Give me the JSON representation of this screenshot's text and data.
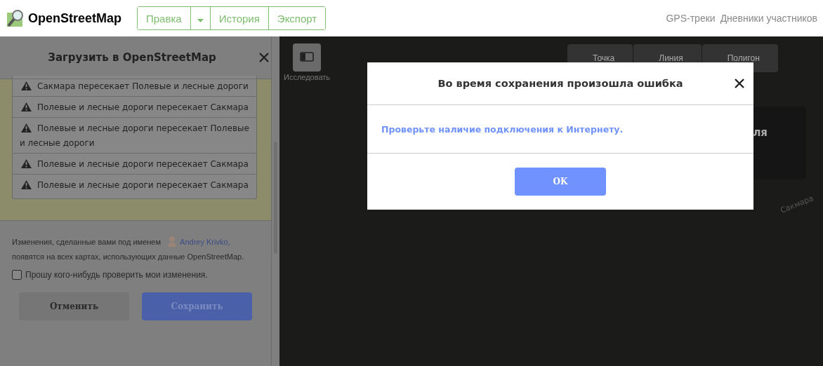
{
  "header": {
    "logo": "OpenStreetMap",
    "edit_tabs": [
      {
        "label": "Правка",
        "kind": "text"
      },
      {
        "kind": "dropdown"
      },
      {
        "label": "История",
        "kind": "text"
      },
      {
        "label": "Экспорт",
        "kind": "text"
      }
    ],
    "links": [
      "GPS-треки",
      "Дневники участников"
    ]
  },
  "upload_panel": {
    "title": "Загрузить в OpenStreetMap",
    "issues": [
      "Сакмара пересекает Полевые и лесные дороги",
      "Полевые и лесные дороги пересекает Сакмара",
      "Полевые и лесные дороги пересекает Полевые и лесные дороги",
      "Полевые и лесные дороги пересекает Сакмара",
      "Полевые и лесные дороги пересекает Сакмара"
    ],
    "info_before": "Изменения, сделанные вами под именем",
    "user": "Andrey Krivko,",
    "info_after": "появятся на всех картах, использующих данные OpenStreetMap.",
    "review": {
      "label": "Прошу кого-нибудь проверить мои изменения.",
      "checked": false
    },
    "cancel": "Отменить",
    "save": "Сохранить"
  },
  "map": {
    "explore_label": "Исследовать",
    "draw_tools": [
      "Точка",
      "Линия",
      "Полигон"
    ],
    "panel_fragment": "ля",
    "river_label": "Сакмара"
  },
  "dialog": {
    "title": "Во время сохранения произошла ошибка",
    "message": "Проверьте наличие подключения к Интернету.",
    "ok": "OK"
  }
}
